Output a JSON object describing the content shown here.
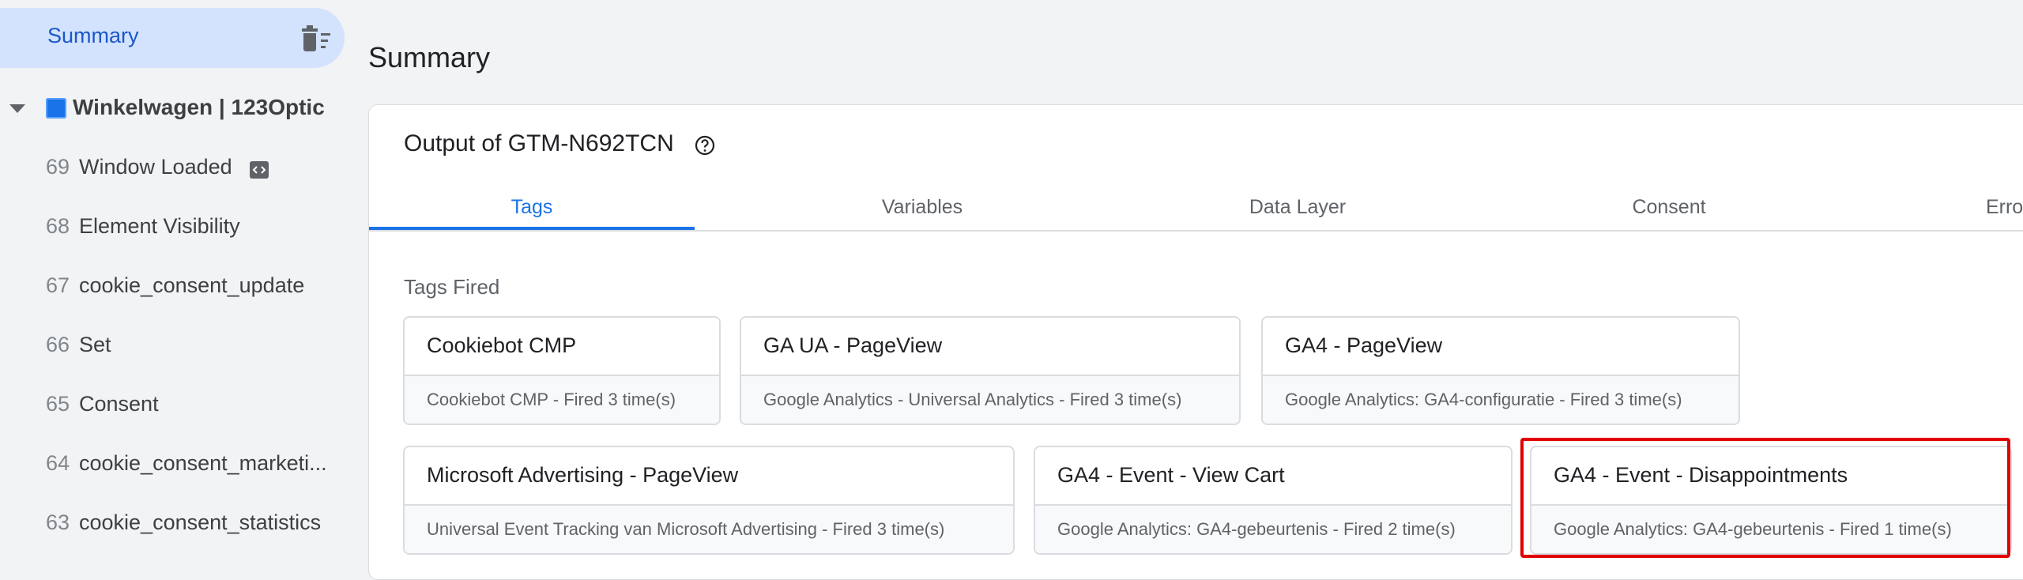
{
  "sidebar": {
    "summary_label": "Summary",
    "summary_icon": "delete-sweep-icon",
    "container": {
      "label": "Winkelwagen | 123Optic",
      "icon": "blue-square"
    },
    "events": [
      {
        "num": "69",
        "name": "Window Loaded",
        "has_icon": true
      },
      {
        "num": "68",
        "name": "Element Visibility"
      },
      {
        "num": "67",
        "name": "cookie_consent_update"
      },
      {
        "num": "66",
        "name": "Set"
      },
      {
        "num": "65",
        "name": "Consent"
      },
      {
        "num": "64",
        "name": "cookie_consent_marketi..."
      },
      {
        "num": "63",
        "name": "cookie_consent_statistics"
      }
    ]
  },
  "main": {
    "title": "Summary",
    "output_title": "Output of GTM-N692TCN",
    "tabs": [
      "Tags",
      "Variables",
      "Data Layer",
      "Consent",
      "Errors"
    ],
    "active_tab": "Tags",
    "section_label": "Tags Fired",
    "tags": [
      {
        "name": "Cookiebot CMP",
        "desc": "Cookiebot CMP - Fired 3 time(s)"
      },
      {
        "name": "GA UA - PageView",
        "desc": "Google Analytics - Universal Analytics - Fired 3 time(s)"
      },
      {
        "name": "GA4 - PageView",
        "desc": "Google Analytics: GA4-configuratie - Fired 3 time(s)"
      },
      {
        "name": "Microsoft Advertising - PageView",
        "desc": "Universal Event Tracking van Microsoft Advertising - Fired 3 time(s)"
      },
      {
        "name": "GA4 - Event - View Cart",
        "desc": "Google Analytics: GA4-gebeurtenis - Fired 2 time(s)"
      },
      {
        "name": "GA4 - Event - Disappointments",
        "desc": "Google Analytics: GA4-gebeurtenis - Fired 1 time(s)"
      }
    ]
  },
  "colors": {
    "accent": "#1a73e8",
    "highlight": "#e00000",
    "selected_bg": "#d3e3fd"
  }
}
